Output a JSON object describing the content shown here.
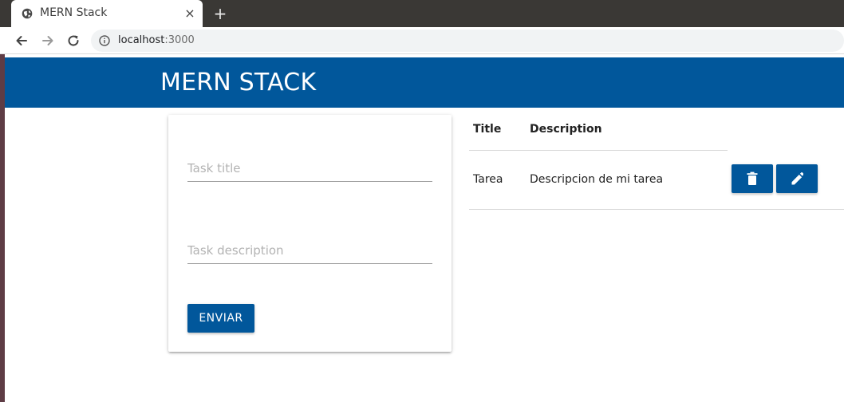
{
  "browser": {
    "tab_title": "MERN Stack",
    "tab_close_glyph": "×",
    "new_tab_glyph": "+",
    "url_host": "localhost",
    "url_port": ":3000"
  },
  "app": {
    "brand": "MERN STACK",
    "form": {
      "title_placeholder": "Task title",
      "title_value": "",
      "description_placeholder": "Task description",
      "description_value": "",
      "submit_label": "ENVIAR"
    },
    "table": {
      "headers": [
        "Title",
        "Description"
      ],
      "rows": [
        {
          "title": "Tarea",
          "description": "Descripcion de mi tarea",
          "actions": [
            "delete-icon",
            "edit-icon"
          ]
        }
      ]
    }
  },
  "colors": {
    "primary": "#01579b",
    "tabstrip": "#3a3835",
    "omnibox": "#f1f3f4"
  }
}
